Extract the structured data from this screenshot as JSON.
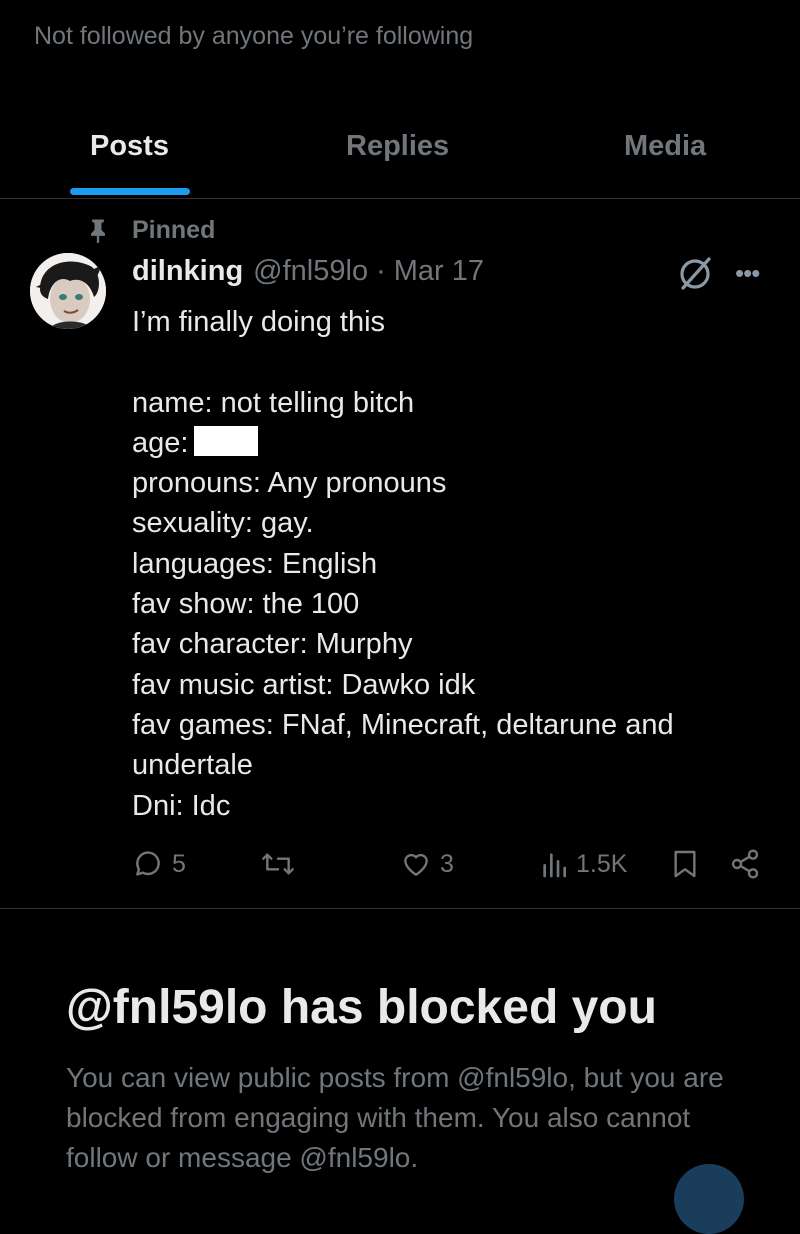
{
  "profile": {
    "followed_note": "Not followed by anyone you’re following"
  },
  "tabs": [
    {
      "label": "Posts",
      "active": true
    },
    {
      "label": "Replies",
      "active": false
    },
    {
      "label": "Media",
      "active": false
    }
  ],
  "accent_color": "#1d9bf0",
  "post": {
    "pinned_label": "Pinned",
    "author_name": "dilnking",
    "handle": "@fnl59lo",
    "separator": "·",
    "date": "Mar 17",
    "more_label": "•••",
    "lines": [
      "I’m finally doing this",
      "",
      "name: not telling bitch",
      "age:",
      "pronouns: Any pronouns",
      "sexuality: gay.",
      "languages:  English",
      "fav show:  the 100",
      "fav character: Murphy",
      "fav music artist: Dawko idk",
      "fav games:  FNaf,  Minecraft, deltarune and",
      "undertale",
      "Dni:   Idc"
    ],
    "actions": {
      "replies": "5",
      "reposts": "",
      "likes": "3",
      "views": "1.5K"
    }
  },
  "blocked": {
    "title": "@fnl59lo has blocked you",
    "description": "You can view public posts from @fnl59lo, but you are blocked from engaging with them. You also cannot follow or message @fnl59lo."
  }
}
